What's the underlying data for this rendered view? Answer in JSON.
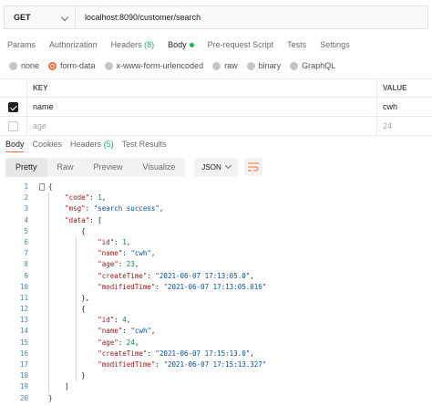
{
  "request": {
    "method": "GET",
    "url": "localhost:8090/customer/search"
  },
  "request_tabs": [
    {
      "label": "Params"
    },
    {
      "label": "Authorization"
    },
    {
      "label": "Headers",
      "count": "(8)"
    },
    {
      "label": "Body"
    },
    {
      "label": "Pre-request Script"
    },
    {
      "label": "Tests"
    },
    {
      "label": "Settings"
    }
  ],
  "body_types": [
    "none",
    "form-data",
    "x-www-form-urlencoded",
    "raw",
    "binary",
    "GraphQL"
  ],
  "params": {
    "headers": {
      "key": "KEY",
      "value": "VALUE"
    },
    "rows": [
      {
        "key": "name",
        "value": "cwh"
      },
      {
        "key": "age",
        "value": "24"
      }
    ]
  },
  "response_tabs": [
    {
      "label": "Body"
    },
    {
      "label": "Cookies"
    },
    {
      "label": "Headers",
      "count": "(5)"
    },
    {
      "label": "Test Results"
    }
  ],
  "view_modes": [
    "Pretty",
    "Raw",
    "Preview",
    "Visualize"
  ],
  "format": "JSON",
  "code_lines": [
    {
      "n": "1",
      "indent": 0,
      "parts": [
        [
          "p",
          "{"
        ]
      ]
    },
    {
      "n": "2",
      "indent": 1,
      "parts": [
        [
          "k",
          "\"code\""
        ],
        [
          "p",
          ": "
        ],
        [
          "n",
          "1"
        ],
        [
          "p",
          ","
        ]
      ]
    },
    {
      "n": "3",
      "indent": 1,
      "parts": [
        [
          "k",
          "\"msg\""
        ],
        [
          "p",
          ": "
        ],
        [
          "s",
          "\"search success\""
        ],
        [
          "p",
          ","
        ]
      ]
    },
    {
      "n": "4",
      "indent": 1,
      "parts": [
        [
          "k",
          "\"data\""
        ],
        [
          "p",
          ": ["
        ]
      ]
    },
    {
      "n": "5",
      "indent": 2,
      "parts": [
        [
          "p",
          "{"
        ]
      ]
    },
    {
      "n": "6",
      "indent": 3,
      "parts": [
        [
          "k",
          "\"id\""
        ],
        [
          "p",
          ": "
        ],
        [
          "n",
          "1"
        ],
        [
          "p",
          ","
        ]
      ]
    },
    {
      "n": "7",
      "indent": 3,
      "parts": [
        [
          "k",
          "\"name\""
        ],
        [
          "p",
          ": "
        ],
        [
          "s",
          "\"cwh\""
        ],
        [
          "p",
          ","
        ]
      ]
    },
    {
      "n": "8",
      "indent": 3,
      "parts": [
        [
          "k",
          "\"age\""
        ],
        [
          "p",
          ": "
        ],
        [
          "n",
          "23"
        ],
        [
          "p",
          ","
        ]
      ]
    },
    {
      "n": "9",
      "indent": 3,
      "parts": [
        [
          "k",
          "\"createTime\""
        ],
        [
          "p",
          ": "
        ],
        [
          "s",
          "\"2021-06-07 17:13:05.0\""
        ],
        [
          "p",
          ","
        ]
      ]
    },
    {
      "n": "10",
      "indent": 3,
      "parts": [
        [
          "k",
          "\"modifiedTime\""
        ],
        [
          "p",
          ": "
        ],
        [
          "s",
          "\"2021-06-07 17:13:05.016\""
        ]
      ]
    },
    {
      "n": "11",
      "indent": 2,
      "parts": [
        [
          "p",
          "},"
        ]
      ]
    },
    {
      "n": "12",
      "indent": 2,
      "parts": [
        [
          "p",
          "{"
        ]
      ]
    },
    {
      "n": "13",
      "indent": 3,
      "parts": [
        [
          "k",
          "\"id\""
        ],
        [
          "p",
          ": "
        ],
        [
          "n",
          "4"
        ],
        [
          "p",
          ","
        ]
      ]
    },
    {
      "n": "14",
      "indent": 3,
      "parts": [
        [
          "k",
          "\"name\""
        ],
        [
          "p",
          ": "
        ],
        [
          "s",
          "\"cwh\""
        ],
        [
          "p",
          ","
        ]
      ]
    },
    {
      "n": "15",
      "indent": 3,
      "parts": [
        [
          "k",
          "\"age\""
        ],
        [
          "p",
          ": "
        ],
        [
          "n",
          "24"
        ],
        [
          "p",
          ","
        ]
      ]
    },
    {
      "n": "16",
      "indent": 3,
      "parts": [
        [
          "k",
          "\"createTime\""
        ],
        [
          "p",
          ": "
        ],
        [
          "s",
          "\"2021-06-07 17:15:13.0\""
        ],
        [
          "p",
          ","
        ]
      ]
    },
    {
      "n": "17",
      "indent": 3,
      "parts": [
        [
          "k",
          "\"modifiedTime\""
        ],
        [
          "p",
          ": "
        ],
        [
          "s",
          "\"2021-06-07 17:15:13.327\""
        ]
      ]
    },
    {
      "n": "18",
      "indent": 2,
      "parts": [
        [
          "p",
          "}"
        ]
      ]
    },
    {
      "n": "19",
      "indent": 1,
      "parts": [
        [
          "p",
          "]"
        ]
      ]
    },
    {
      "n": "20",
      "indent": 0,
      "parts": [
        [
          "p",
          "}"
        ]
      ]
    }
  ],
  "fold_lines": [
    "1",
    "4",
    "5",
    "12"
  ],
  "colors": {
    "accent": "#ff6c37",
    "success": "#0cbb52",
    "key": "#a41515",
    "string": "#0451a5",
    "number": "#098658",
    "line_number": "#3d8bb5"
  },
  "icons": {
    "method_dropdown": "chevron-down-icon",
    "format_dropdown": "chevron-down-icon",
    "wrap": "wrap-lines-icon",
    "checkbox": "checkbox-icon"
  }
}
